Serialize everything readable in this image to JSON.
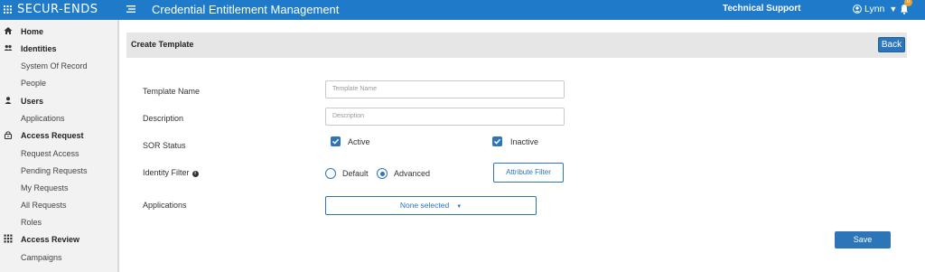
{
  "topbar": {
    "logo": "SECUR-ENDS",
    "app_title": "Credential Entitlement Management",
    "support": "Technical Support",
    "user": "Lynn",
    "notification_count": "0",
    "accent_color": "#1f7bc9"
  },
  "sidebar": {
    "items": [
      {
        "label": "Home",
        "type": "head",
        "icon": "home-icon"
      },
      {
        "label": "Identities",
        "type": "head",
        "icon": "users-icon"
      },
      {
        "label": "System Of Record",
        "type": "sub"
      },
      {
        "label": "People",
        "type": "sub"
      },
      {
        "label": "Users",
        "type": "head",
        "icon": "user-icon"
      },
      {
        "label": "Applications",
        "type": "sub"
      },
      {
        "label": "Access Request",
        "type": "head",
        "icon": "lock-icon"
      },
      {
        "label": "Request Access",
        "type": "sub"
      },
      {
        "label": "Pending Requests",
        "type": "sub"
      },
      {
        "label": "My Requests",
        "type": "sub"
      },
      {
        "label": "All Requests",
        "type": "sub"
      },
      {
        "label": "Roles",
        "type": "sub"
      },
      {
        "label": "Access Review",
        "type": "head",
        "icon": "grid-icon"
      },
      {
        "label": "Campaigns",
        "type": "sub"
      }
    ]
  },
  "page": {
    "title": "Create Template",
    "back_label": "Back"
  },
  "form": {
    "template_name_label": "Template Name",
    "template_name_placeholder": "Template Name",
    "description_label": "Description",
    "description_placeholder": "Description",
    "sor_status_label": "SOR Status",
    "active_label": "Active",
    "inactive_label": "Inactive",
    "identity_filter_label": "Identity Filter",
    "default_label": "Default",
    "advanced_label": "Advanced",
    "attribute_filter_label": "Attribute Filter",
    "applications_label": "Applications",
    "applications_value": "None selected",
    "save_label": "Save"
  }
}
